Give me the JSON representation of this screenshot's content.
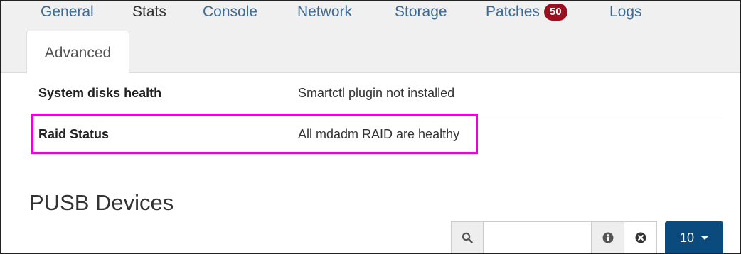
{
  "tabs": {
    "general": "General",
    "stats": "Stats",
    "console": "Console",
    "network": "Network",
    "storage": "Storage",
    "patches": "Patches",
    "patches_badge": "50",
    "logs": "Logs",
    "advanced": "Advanced"
  },
  "health_table": {
    "rows": [
      {
        "label": "System disks health",
        "value": "Smartctl plugin not installed"
      },
      {
        "label": "Raid Status",
        "value": "All mdadm RAID are healthy"
      }
    ]
  },
  "pusb": {
    "title": "PUSB Devices",
    "search_value": "",
    "page_size": "10"
  },
  "icons": {
    "search": "search-icon",
    "info": "info-circle-icon",
    "clear": "times-circle-icon",
    "dropdown": "caret-down-icon"
  },
  "colors": {
    "link": "#3e6a93",
    "badge": "#9b1020",
    "highlight": "#ee00dd",
    "primary_button": "#0b4a7d"
  }
}
